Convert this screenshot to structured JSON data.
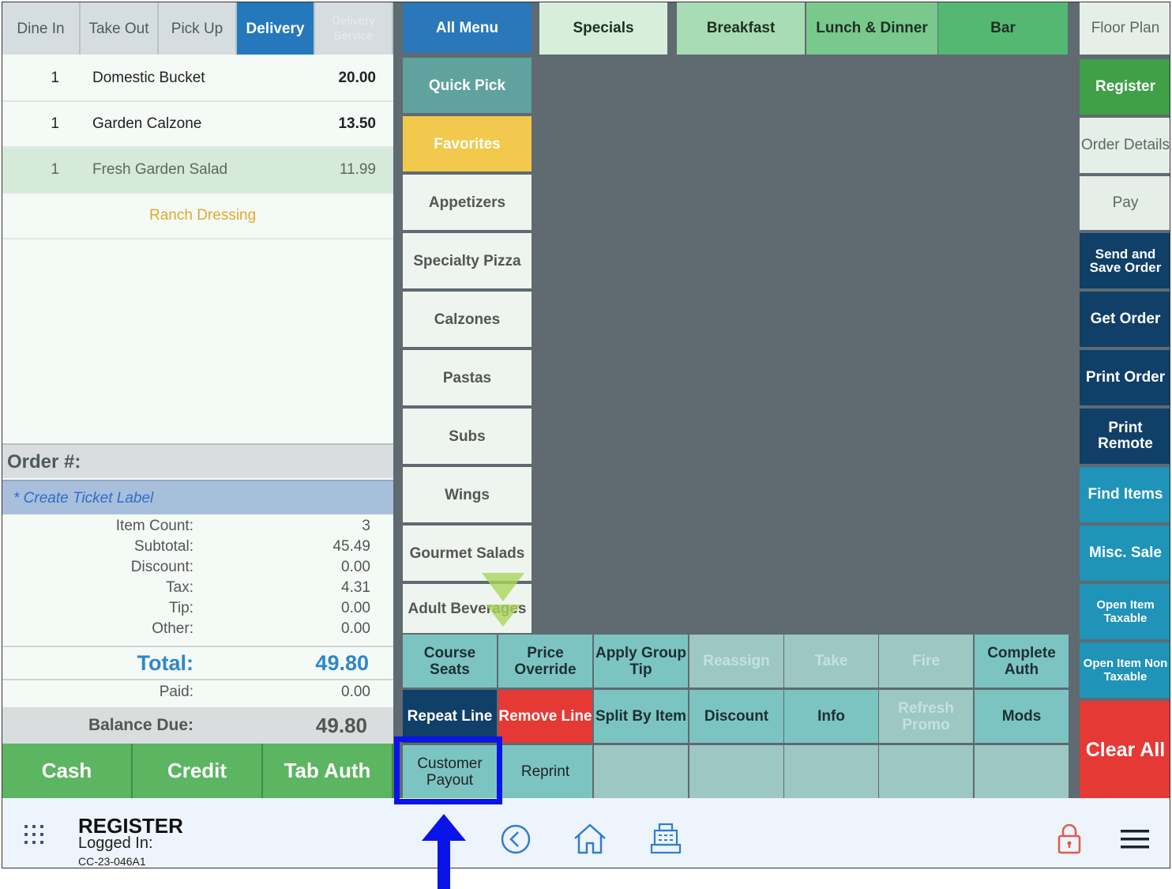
{
  "order_types": [
    {
      "label": "Dine In",
      "state": "normal"
    },
    {
      "label": "Take Out",
      "state": "normal"
    },
    {
      "label": "Pick Up",
      "state": "normal"
    },
    {
      "label": "Delivery",
      "state": "active"
    },
    {
      "label": "Delivery Service",
      "state": "dim"
    }
  ],
  "order_lines": [
    {
      "qty": "1",
      "name": "Domestic Bucket",
      "price": "20.00"
    },
    {
      "qty": "1",
      "name": "Garden Calzone",
      "price": "13.50"
    },
    {
      "qty": "1",
      "name": "Fresh Garden Salad",
      "price": "11.99"
    },
    {
      "qty": "",
      "name": "Ranch Dressing",
      "price": ""
    }
  ],
  "order": {
    "number_label": "Order #:",
    "ticket_label": "* Create Ticket Label",
    "totals": [
      {
        "label": "Item Count:",
        "value": "3"
      },
      {
        "label": "Subtotal:",
        "value": "45.49"
      },
      {
        "label": "Discount:",
        "value": "0.00"
      },
      {
        "label": "Tax:",
        "value": "4.31"
      },
      {
        "label": "Tip:",
        "value": "0.00"
      },
      {
        "label": "Other:",
        "value": "0.00"
      }
    ],
    "total_label": "Total:",
    "total_value": "49.80",
    "paid_label": "Paid:",
    "paid_value": "0.00",
    "balance_label": "Balance Due:",
    "balance_value": "49.80"
  },
  "payment_buttons": [
    "Cash",
    "Credit",
    "Tab Auth"
  ],
  "categories": [
    "All Menu",
    "Quick Pick",
    "Favorites",
    "Appetizers",
    "Specialty Pizza",
    "Calzones",
    "Pastas",
    "Subs",
    "Wings",
    "Gourmet Salads",
    "Adult Beverages"
  ],
  "menu_tabs": [
    {
      "label": "Specials",
      "color": "#d7eedb"
    },
    {
      "label": "Breakfast",
      "color": "#a8dcb4"
    },
    {
      "label": "Lunch & Dinner",
      "color": "#79c98d"
    },
    {
      "label": "Bar",
      "color": "#55b872"
    }
  ],
  "right_buttons": [
    "Floor Plan",
    "Register",
    "Order Details",
    "Pay",
    "Send and Save Order",
    "Get Order",
    "Print Order",
    "Print Remote",
    "Find Items",
    "Misc. Sale",
    "Open Item Taxable",
    "Open Item Non Taxable",
    "Clear All"
  ],
  "action_buttons": [
    [
      "Course Seats",
      "Price Override",
      "Apply Group Tip",
      "Reassign",
      "Take",
      "Fire",
      "Complete Auth"
    ],
    [
      "Repeat Line",
      "Remove Line",
      "Split By Item",
      "Discount",
      "Info",
      "Refresh Promo",
      "Mods"
    ],
    [
      "Customer Payout",
      "Reprint",
      "",
      "",
      "",
      "",
      ""
    ]
  ],
  "footer": {
    "title": "REGISTER",
    "logged_in": "Logged In:",
    "terminal_id": "CC-23-046A1"
  },
  "icons": [
    "apps-grid-icon",
    "back-icon",
    "home-icon",
    "cash-register-icon",
    "lock-icon",
    "menu-icon"
  ],
  "colors": {
    "highlight": "#0a14e8",
    "delivery_active": "#2478bb",
    "clear_all": "#e53935"
  }
}
